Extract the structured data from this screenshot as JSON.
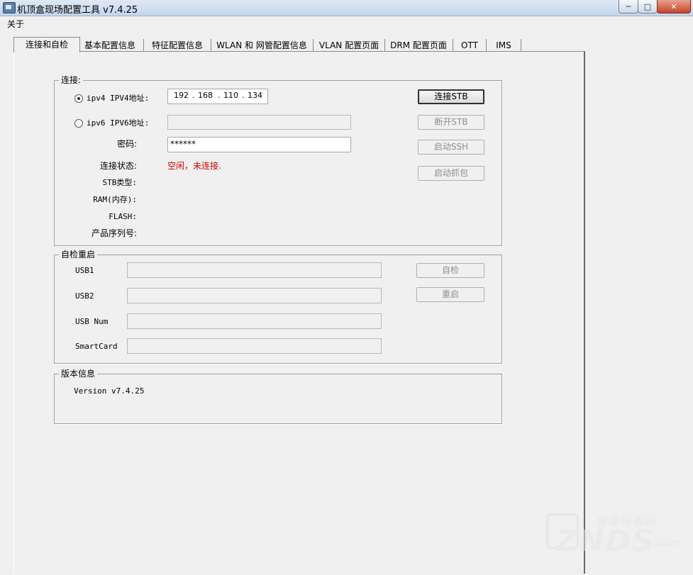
{
  "window": {
    "title": "机顶盒现场配置工具 v7.4.25",
    "minimize_glyph": "─",
    "maximize_glyph": "□",
    "close_glyph": "✕"
  },
  "menu": {
    "about": "关于"
  },
  "tabs": [
    {
      "label": "连接和自检",
      "active": true
    },
    {
      "label": "基本配置信息"
    },
    {
      "label": "特征配置信息"
    },
    {
      "label": "WLAN 和 网管配置信息"
    },
    {
      "label": "VLAN 配置页面"
    },
    {
      "label": "DRM 配置页面"
    },
    {
      "label": "OTT"
    },
    {
      "label": "IMS"
    }
  ],
  "connect": {
    "group_title": "连接:",
    "ipv4_label": "ipv4  IPV4地址:",
    "ipv4_selected": true,
    "ipv4": {
      "o1": "192",
      "o2": "168",
      "o3": "110",
      "o4": "134"
    },
    "ipv6_label": "ipv6  IPV6地址:",
    "ipv6_value": "",
    "password_label": "密码:",
    "password_value": "******",
    "status_label": "连接状态:",
    "status_value": "空闲，未连接.",
    "status_color": "#cc0000",
    "stb_type_label": "STB类型:",
    "ram_label": "RAM(内存):",
    "flash_label": "FLASH:",
    "serial_label": "产品序列号:",
    "btn_connect": "连接STB",
    "btn_disconnect": "断开STB",
    "btn_ssh": "启动SSH",
    "btn_capture": "启动抓包"
  },
  "selftest": {
    "group_title": "自检重启",
    "usb1_label": "USB1",
    "usb2_label": "USB2",
    "usbnum_label": "USB Num",
    "smartcard_label": "SmartCard",
    "usb1_value": "",
    "usb2_value": "",
    "usbnum_value": "",
    "smartcard_value": "",
    "btn_selftest": "自检",
    "btn_reboot": "重启"
  },
  "version": {
    "group_title": "版本信息",
    "text": "Version v7.4.25"
  },
  "watermark": {
    "small": "智能电视网",
    "big": "ZNDS",
    "suffix": ".com"
  }
}
